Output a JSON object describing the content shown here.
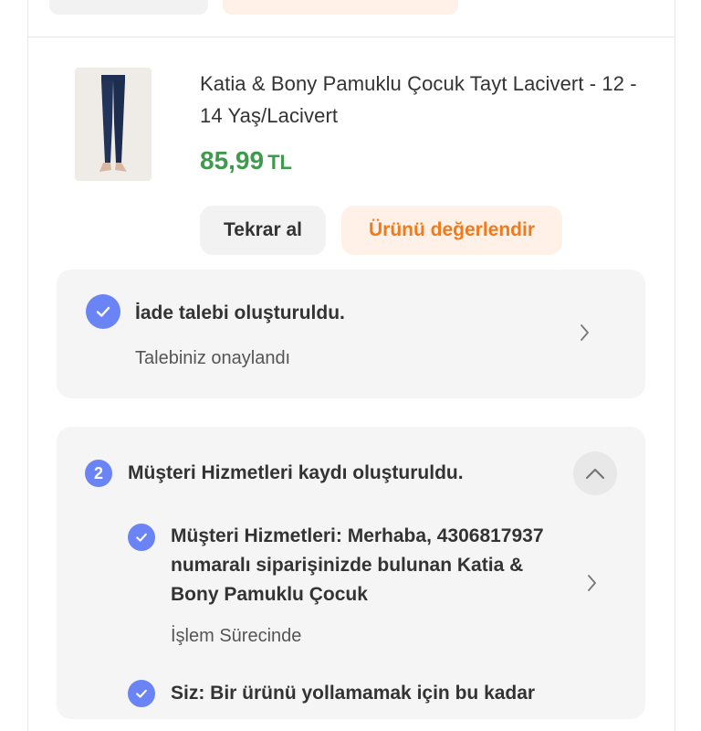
{
  "product": {
    "title": "Katia & Bony Pamuklu Çocuk Tayt Lacivert - 12 - 14 Yaş/Lacivert",
    "price": "85,99",
    "currency": "TL",
    "thumbnail_icon": "leggings-image"
  },
  "actions": {
    "rebuy_label": "Tekrar al",
    "review_label": "Ürünü değerlendir"
  },
  "return_status": {
    "title": "İade talebi oluşturuldu.",
    "subtitle": "Talebiniz onaylandı"
  },
  "customer_service": {
    "step_number": "2",
    "title": "Müşteri Hizmetleri kaydı oluşturuldu.",
    "messages": [
      {
        "text": "Müşteri Hizmetleri: Merhaba, 4306817937 numaralı siparişinizde bulunan Katia & Bony Pamuklu Çocuk",
        "status": "İşlem Sürecinde"
      },
      {
        "text": "Siz: Bir ürünü yollamamak için bu kadar"
      }
    ]
  },
  "colors": {
    "accent_orange": "#f27a1a",
    "price_green": "#3f9a4e",
    "status_blue": "#6b84f5"
  }
}
